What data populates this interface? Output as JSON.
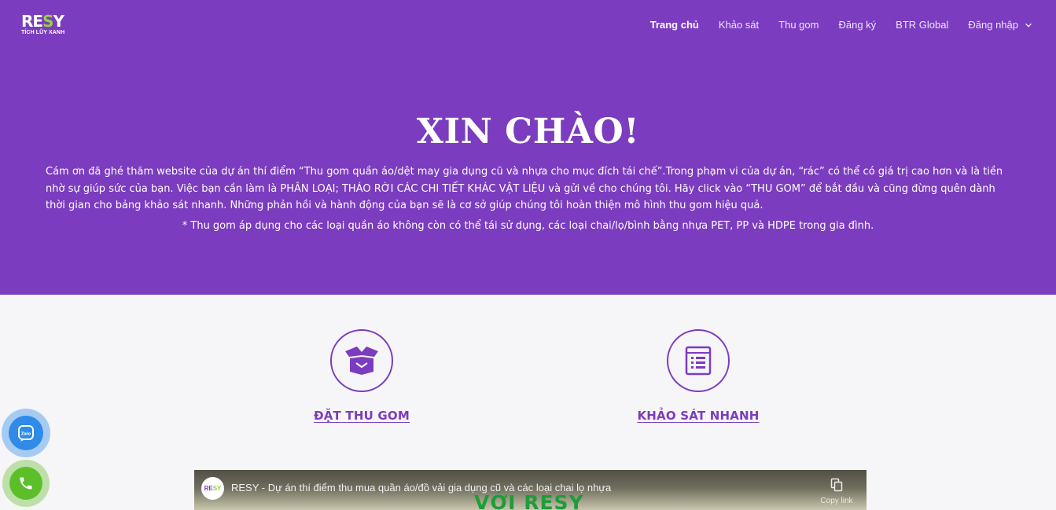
{
  "brand": {
    "logo_main_left": "RE",
    "logo_main_accent": "S",
    "logo_main_right": "Y",
    "logo_sub": "TÍCH LŨY XANH",
    "colors": {
      "primary": "#7b3cbf",
      "accent": "#95d13d",
      "background": "#f6f5f8"
    }
  },
  "nav": {
    "items": [
      {
        "label": "Trang chủ",
        "active": true
      },
      {
        "label": "Khảo sát"
      },
      {
        "label": "Thu gom"
      },
      {
        "label": "Đăng ký"
      },
      {
        "label": "BTR Global"
      },
      {
        "label": "Đăng nhập",
        "icon": "chevron-down-icon"
      }
    ]
  },
  "hero": {
    "title": "XIN CHÀO!",
    "text": "Cám ơn đã ghé thăm website của dự án thí điểm “Thu gom quần áo/dệt may gia dụng cũ và nhựa cho mục đích tái chế”.Trong phạm vi của dự án, “rác” có thể có giá trị cao hơn và là tiền nhờ sự giúp sức của bạn. Việc bạn cần làm là PHÂN LOẠI; THÁO RỜI CÁC CHI TIẾT KHÁC VẬT LIỆU và gửi về cho chúng tôi. Hãy click vào “THU GOM” để bắt đầu và cũng đừng quên dành thời gian cho bảng khảo sát nhanh. Những phản hồi và hành động của bạn sẽ là cơ sở giúp chúng tôi hoàn thiện mô hình thu gom hiệu quả.",
    "note": "* Thu gom áp dụng cho các loại quần áo không còn có thể tái sử dụng, các loại chai/lọ/bình bằng nhựa PET, PP và HDPE trong gia đình."
  },
  "features": [
    {
      "label": "ĐẶT THU GOM",
      "icon": "open-box-icon"
    },
    {
      "label": "KHẢO SÁT NHANH",
      "icon": "survey-list-icon"
    }
  ],
  "video": {
    "channel_logo_left": "RE",
    "channel_logo_accent": "SY",
    "title": "RESY - Dự án thí điểm thu mua quần áo/đồ vải gia dụng cũ và các loại chai lọ nhựa",
    "copy_label": "Copy link",
    "overlay_text": "VỚI RESY"
  },
  "floating": {
    "zalo_label": "Zalo"
  }
}
